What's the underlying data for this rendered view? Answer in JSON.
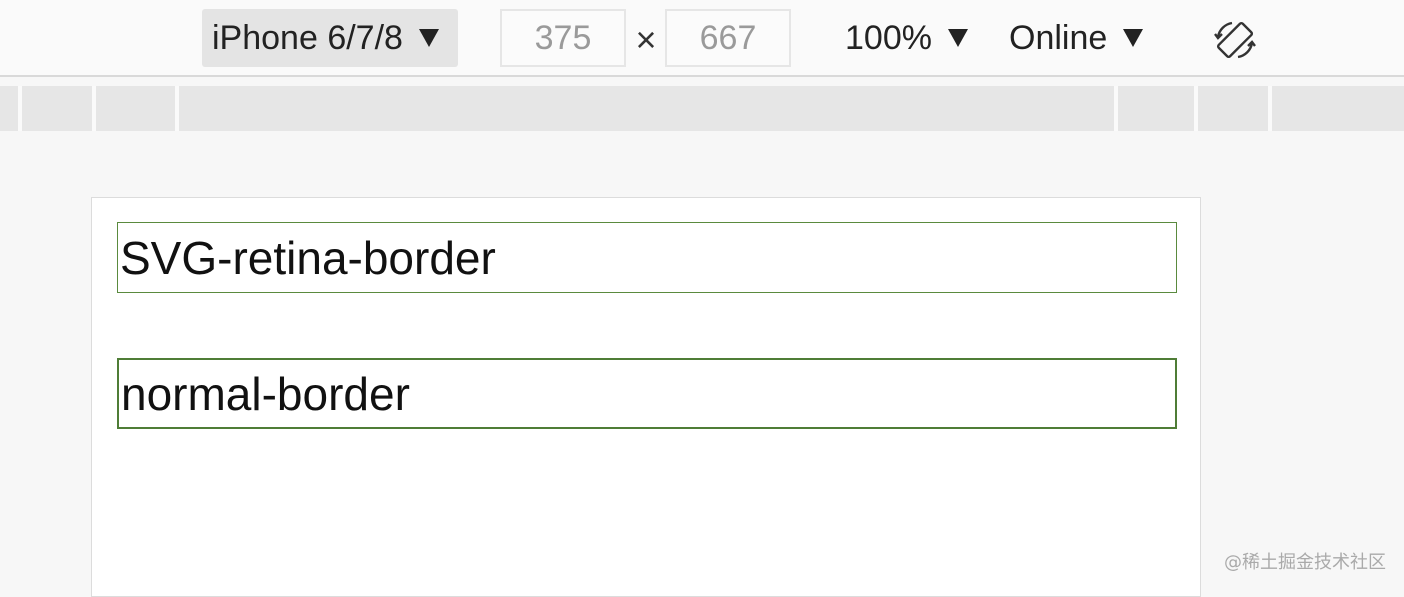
{
  "toolbar": {
    "device": "iPhone 6/7/8",
    "width_value": "375",
    "separator": "×",
    "height_value": "667",
    "zoom": "100%",
    "network": "Online",
    "rotate_icon": "rotate-device-icon"
  },
  "page": {
    "items": [
      {
        "label": "SVG-retina-border",
        "border_color": "#5a8a3e"
      },
      {
        "label": "normal-border",
        "border_color": "#4f7d36"
      }
    ]
  },
  "watermark": "@稀土掘金技术社区"
}
